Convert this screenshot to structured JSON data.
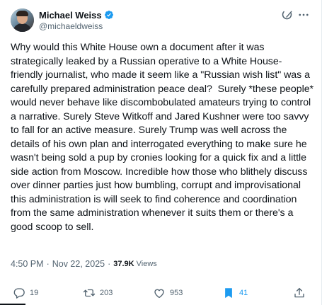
{
  "author": {
    "display_name": "Michael Weiss",
    "handle": "@michaeldweiss",
    "verified": true
  },
  "tweet": {
    "text": "Why would this White House own a document after it was strategically leaked by a Russian operative to a White House-friendly journalist, who made it seem like a \"Russian wish list\" was a carefully prepared administration peace deal?  Surely *these people* would never behave like discombobulated amateurs trying to control a narrative. Surely Steve Witkoff and Jared Kushner were too savvy to fall for an active measure. Surely Trump was well across the details of his own plan and interrogated everything to make sure he wasn't being sold a pup by cronies looking for a quick fix and a little side action from Moscow. Incredible how those who blithely discuss over dinner parties just how bumbling, corrupt and improvisational this administration is will seek to find coherence and coordination from the same administration whenever it suits them or there's a good scoop to sell.",
    "time": "4:50 PM",
    "date": "Nov 22, 2025",
    "views_count": "37.9K",
    "views_label": "Views"
  },
  "actions": {
    "replies": "19",
    "retweets": "203",
    "likes": "953",
    "bookmarks": "41"
  },
  "icons": {
    "verified": "verified-badge-icon",
    "grok": "grok-icon",
    "more": "more-icon",
    "reply": "reply-icon",
    "retweet": "retweet-icon",
    "like": "heart-icon",
    "bookmark": "bookmark-icon",
    "share": "share-icon"
  },
  "colors": {
    "text": "#0f1419",
    "secondary": "#536471",
    "accent": "#1d9bf0"
  }
}
